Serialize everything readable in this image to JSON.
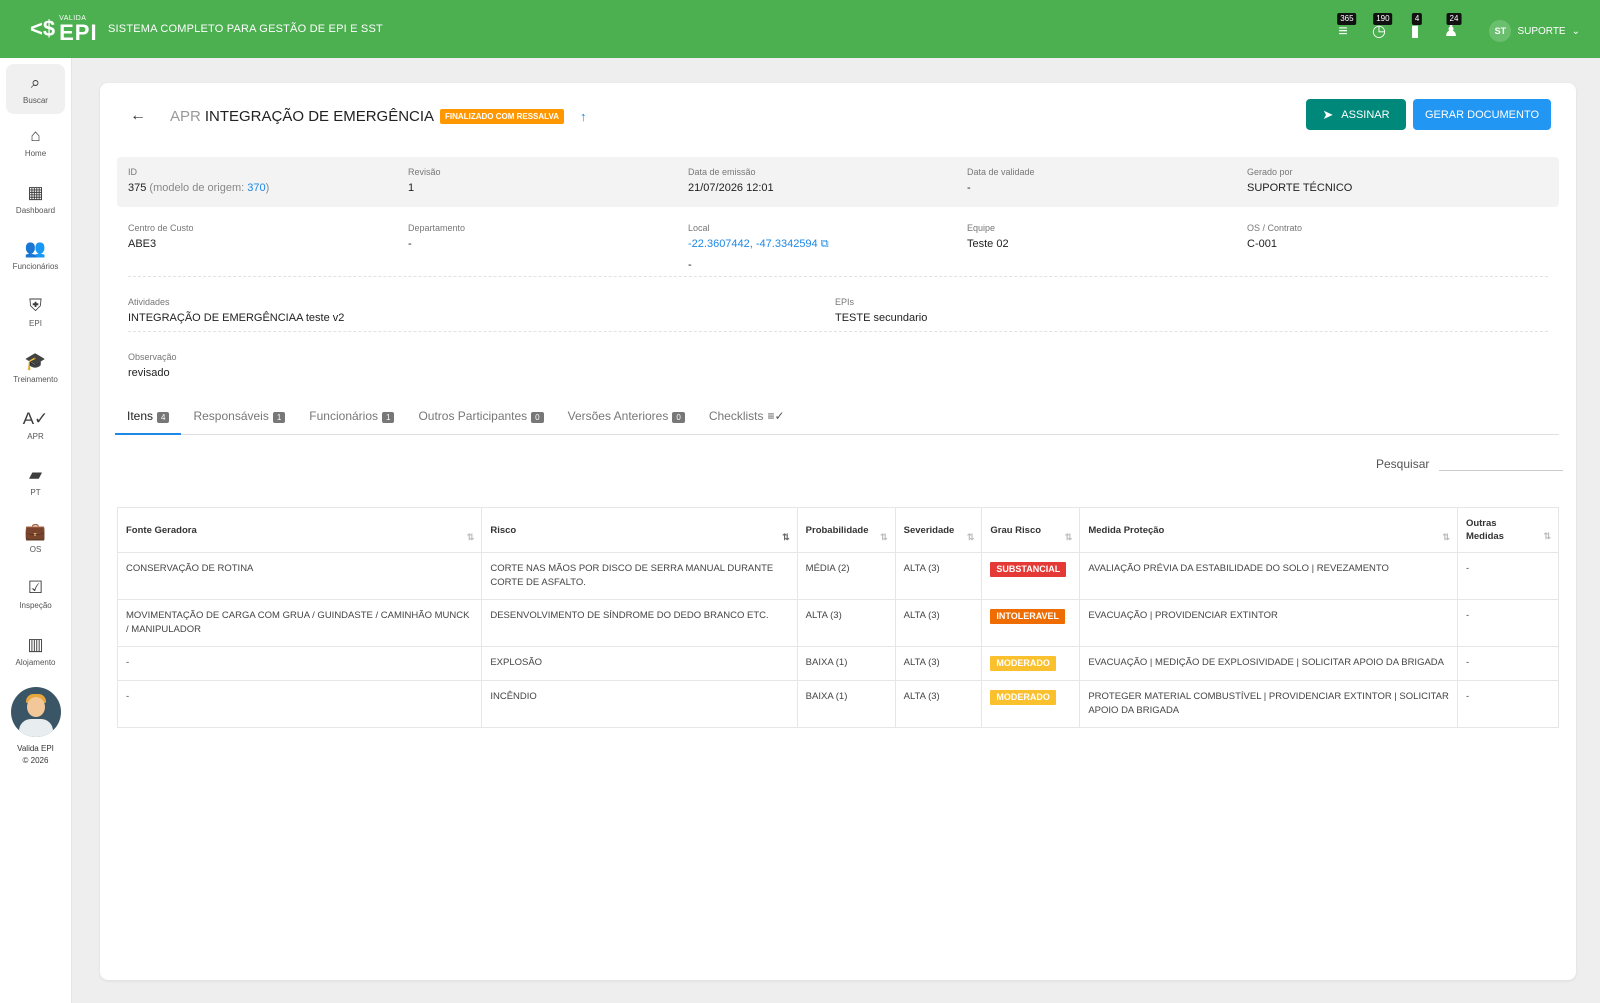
{
  "header": {
    "logo_small": "VALIDA",
    "logo_big": "EPI",
    "tagline": "SISTEMA COMPLETO PARA GESTÃO DE EPI E SST",
    "notifications": [
      {
        "icon": "list-x-icon",
        "count": "365"
      },
      {
        "icon": "history-icon",
        "count": "190"
      },
      {
        "icon": "clipboard-icon",
        "count": "4"
      },
      {
        "icon": "bell-icon",
        "count": "24"
      }
    ],
    "user_initials": "ST",
    "user_name": "SUPORTE"
  },
  "sidebar": {
    "items": [
      {
        "label": "Buscar",
        "icon": "search-icon"
      },
      {
        "label": "Home",
        "icon": "home-icon"
      },
      {
        "label": "Dashboard",
        "icon": "dashboard-icon"
      },
      {
        "label": "Funcionários",
        "icon": "people-icon"
      },
      {
        "label": "EPI",
        "icon": "shield-icon"
      },
      {
        "label": "Treinamento",
        "icon": "graduation-cap-icon"
      },
      {
        "label": "APR",
        "icon": "spellcheck-icon"
      },
      {
        "label": "PT",
        "icon": "folder-user-icon"
      },
      {
        "label": "OS",
        "icon": "briefcase-icon"
      },
      {
        "label": "Inspeção",
        "icon": "checklist-icon"
      },
      {
        "label": "Alojamento",
        "icon": "building-icon"
      }
    ],
    "footer_name": "Valida EPI",
    "footer_year": "© 2026"
  },
  "page": {
    "title_prefix": "APR",
    "title": "INTEGRAÇÃO DE EMERGÊNCIA",
    "status": "FINALIZADO COM RESSALVA",
    "sign_button": "ASSINAR",
    "doc_button": "GERAR DOCUMENTO"
  },
  "details": {
    "id_label": "ID",
    "id_value": "375",
    "origin_text": "(modelo de origem:",
    "origin_link": "370",
    "origin_close": ")",
    "revisao_label": "Revisão",
    "revisao_value": "1",
    "emissao_label": "Data de emissão",
    "emissao_value": "21/07/2026 12:01",
    "validade_label": "Data de validade",
    "validade_value": "-",
    "gerado_label": "Gerado por",
    "gerado_value": "SUPORTE TÉCNICO",
    "centro_label": "Centro de Custo",
    "centro_value": "ABE3",
    "departamento_label": "Departamento",
    "departamento_value": "-",
    "local_label": "Local",
    "local_link": "-22.3607442, -47.3342594",
    "local_extra": "-",
    "equipe_label": "Equipe",
    "equipe_value": "Teste 02",
    "os_label": "OS / Contrato",
    "os_value": "C-001",
    "atividades_label": "Atividades",
    "atividades_value": "INTEGRAÇÃO DE EMERGÊNCIAA  teste v2",
    "epis_label": "EPIs",
    "epis_value": "TESTE secundario",
    "observacao_label": "Observação",
    "observacao_value": "revisado"
  },
  "tabs": [
    {
      "label": "Itens",
      "count": "4"
    },
    {
      "label": "Responsáveis",
      "count": "1"
    },
    {
      "label": "Funcionários",
      "count": "1"
    },
    {
      "label": "Outros Participantes",
      "count": "0"
    },
    {
      "label": "Versões Anteriores",
      "count": "0"
    },
    {
      "label": "Checklists",
      "count": ""
    }
  ],
  "search": {
    "label": "Pesquisar",
    "value": ""
  },
  "table": {
    "columns": [
      "Fonte Geradora",
      "Risco",
      "Probabilidade",
      "Severidade",
      "Grau Risco",
      "Medida Proteção",
      "Outras Medidas"
    ],
    "rows": [
      {
        "fonte": "CONSERVAÇÃO DE ROTINA",
        "risco": "CORTE NAS MÃOS POR DISCO DE SERRA MANUAL DURANTE CORTE DE ASFALTO.",
        "prob": "MÉDIA (2)",
        "sev": "ALTA (3)",
        "grau": "SUBSTANCIAL",
        "grau_color": "#e53935",
        "medida": "AVALIAÇÃO PRÉVIA DA ESTABILIDADE DO SOLO | REVEZAMENTO",
        "outras": "-"
      },
      {
        "fonte": "MOVIMENTAÇÃO DE CARGA COM GRUA / GUINDASTE / CAMINHÃO MUNCK / MANIPULADOR",
        "risco": "DESENVOLVIMENTO DE SÍNDROME DO DEDO BRANCO ETC.",
        "prob": "ALTA (3)",
        "sev": "ALTA (3)",
        "grau": "INTOLERAVEL",
        "grau_color": "#ef6c00",
        "medida": "EVACUAÇÃO | PROVIDENCIAR EXTINTOR",
        "outras": "-"
      },
      {
        "fonte": "-",
        "risco": "EXPLOSÃO",
        "prob": "BAIXA (1)",
        "sev": "ALTA (3)",
        "grau": "MODERADO",
        "grau_color": "#fbc02d",
        "medida": "EVACUAÇÃO | MEDIÇÃO DE EXPLOSIVIDADE | SOLICITAR APOIO DA BRIGADA",
        "outras": "-"
      },
      {
        "fonte": "-",
        "risco": "INCÊNDIO",
        "prob": "BAIXA (1)",
        "sev": "ALTA (3)",
        "grau": "MODERADO",
        "grau_color": "#fbc02d",
        "medida": "PROTEGER MATERIAL COMBUSTÍVEL | PROVIDENCIAR EXTINTOR | SOLICITAR APOIO DA BRIGADA",
        "outras": "-"
      }
    ]
  }
}
